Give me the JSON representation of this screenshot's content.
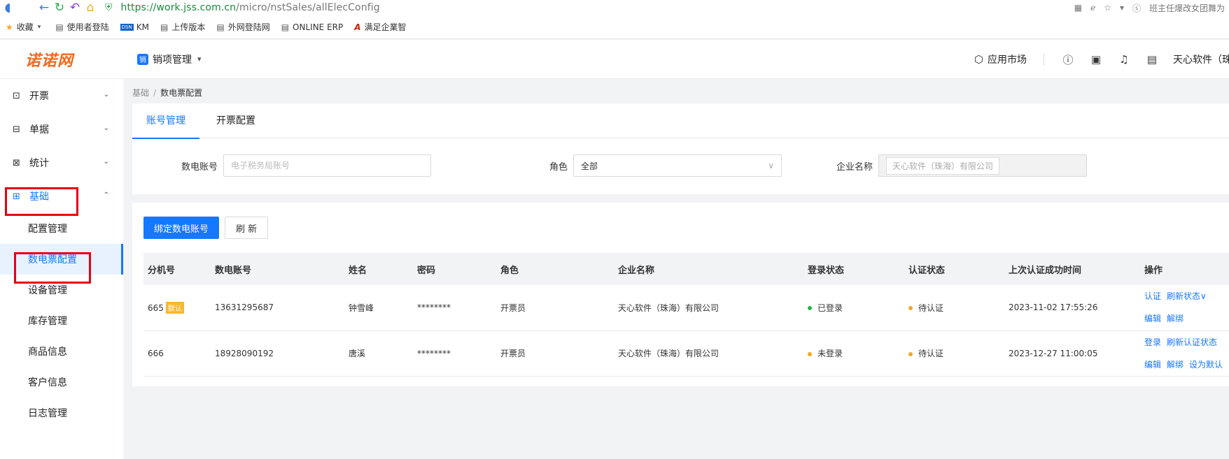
{
  "browser": {
    "url_host": "https://work.jss.com.cn",
    "url_path": "/micro/nstSales/allElecConfig",
    "right_text": "班主任爆改女团舞为"
  },
  "bookmarks": [
    {
      "label": "收藏",
      "icon": "star-icon"
    },
    {
      "label": "使用者登陆",
      "icon": "doc-icon"
    },
    {
      "label": "KM",
      "icon": "km-icon",
      "badge": "DSN"
    },
    {
      "label": "上传版本",
      "icon": "doc-icon"
    },
    {
      "label": "外网登陆网",
      "icon": "doc-icon"
    },
    {
      "label": "ONLINE ERP",
      "icon": "doc-icon"
    },
    {
      "label": "满足企業智",
      "icon": "red-logo-icon",
      "logo_letter": "A"
    }
  ],
  "header": {
    "logo": "诺诺网",
    "module_icon": "销",
    "module": "销项管理",
    "market": "应用市场",
    "company": "天心软件（珠"
  },
  "sidebar": {
    "items": [
      {
        "label": "开票",
        "icon": "invoice-icon",
        "arrow": "⌄"
      },
      {
        "label": "单据",
        "icon": "document-icon",
        "arrow": "⌄"
      },
      {
        "label": "统计",
        "icon": "chart-icon",
        "arrow": "⌄"
      },
      {
        "label": "基础",
        "icon": "base-icon",
        "arrow": "⌃"
      }
    ],
    "sub_items": [
      {
        "label": "配置管理"
      },
      {
        "label": "数电票配置"
      },
      {
        "label": "设备管理"
      },
      {
        "label": "库存管理"
      },
      {
        "label": "商品信息"
      },
      {
        "label": "客户信息"
      },
      {
        "label": "日志管理"
      }
    ]
  },
  "breadcrumb": {
    "root": "基础",
    "sep": "/",
    "current": "数电票配置"
  },
  "tabs": [
    {
      "label": "账号管理"
    },
    {
      "label": "开票配置"
    }
  ],
  "filters": {
    "account_label": "数电账号",
    "account_placeholder": "电子税务局账号",
    "role_label": "角色",
    "role_value": "全部",
    "company_label": "企业名称",
    "company_value": "天心软件（珠海）有限公司"
  },
  "toolbar": {
    "bind_label": "绑定数电账号",
    "refresh_label": "刷 新"
  },
  "table": {
    "columns": [
      "分机号",
      "数电账号",
      "姓名",
      "密码",
      "角色",
      "企业名称",
      "登录状态",
      "认证状态",
      "上次认证成功时间",
      "操作"
    ],
    "rows": [
      {
        "ext": "665",
        "badge": "默认",
        "account": "13631295687",
        "name": "钟雪峰",
        "password": "********",
        "role": "开票员",
        "company": "天心软件（珠海）有限公司",
        "login_status": "已登录",
        "login_color": "#26b34a",
        "auth_status": "待认证",
        "last_auth": "2023-11-02 17:55:26",
        "ops_line1": [
          "认证",
          "刷新状态∨"
        ],
        "ops_line2": [
          "编辑",
          "解绑"
        ]
      },
      {
        "ext": "666",
        "badge": "",
        "account": "18928090192",
        "name": "唐溪",
        "password": "********",
        "role": "开票员",
        "company": "天心软件（珠海）有限公司",
        "login_status": "未登录",
        "login_color": "#f5a623",
        "auth_status": "待认证",
        "last_auth": "2023-12-27 11:00:05",
        "ops_line1": [
          "登录",
          "刷新认证状态"
        ],
        "ops_line2": [
          "编辑",
          "解绑",
          "设为默认"
        ]
      }
    ]
  }
}
